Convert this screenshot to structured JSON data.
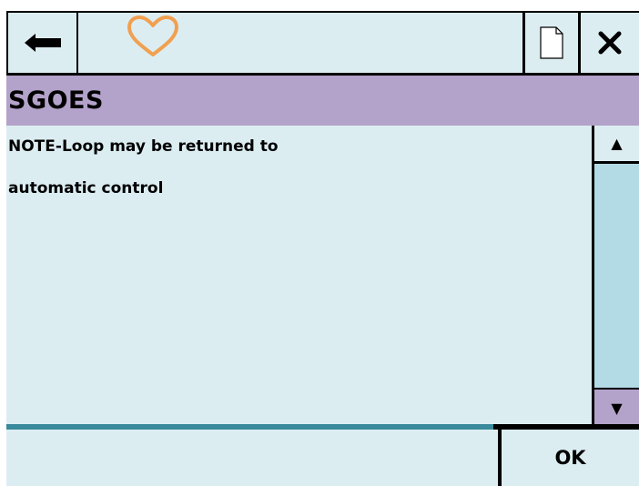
{
  "window": {
    "background": "#dcedf2",
    "accent": "#b3a2c9",
    "progress_color": "#3a8a9c",
    "heart_color": "#f0a050"
  },
  "toolbar": {
    "back_icon": "back-arrow-icon",
    "favorite_icon": "heart-icon",
    "document_icon": "document-icon",
    "close_icon": "close-icon"
  },
  "title": "SGOES",
  "message": {
    "lines": [
      "NOTE-Loop may be returned to",
      "automatic control"
    ]
  },
  "scrollbar": {
    "up_label": "▲",
    "down_label": "▼"
  },
  "progress": {
    "fraction": 0.77
  },
  "footer": {
    "status_text": "",
    "ok_label": "OK"
  }
}
